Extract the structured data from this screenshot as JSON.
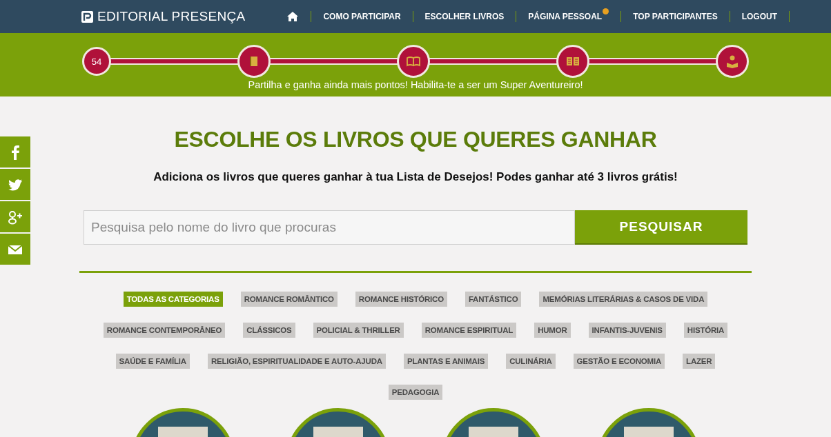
{
  "header": {
    "logo": "EDITORIAL PRESENÇA",
    "nav": [
      {
        "kind": "home"
      },
      {
        "kind": "link",
        "label": "COMO PARTICIPAR",
        "badge": false
      },
      {
        "kind": "link",
        "label": "ESCOLHER LIVROS",
        "badge": false
      },
      {
        "kind": "link",
        "label": "PÁGINA PESSOAL",
        "badge": true
      },
      {
        "kind": "link",
        "label": "TOP PARTICIPANTES",
        "badge": false
      },
      {
        "kind": "link",
        "label": "LOGOUT",
        "badge": false
      }
    ]
  },
  "progress": {
    "steps": [
      {
        "kind": "count",
        "label": "54"
      },
      {
        "kind": "book"
      },
      {
        "kind": "open-book"
      },
      {
        "kind": "text-book"
      },
      {
        "kind": "reader"
      }
    ],
    "message": "Partilha e ganha ainda mais pontos! Habilita-te a ser um Super Aventureiro!"
  },
  "social": [
    {
      "kind": "facebook"
    },
    {
      "kind": "twitter"
    },
    {
      "kind": "googleplus"
    },
    {
      "kind": "email"
    }
  ],
  "title": "ESCOLHE OS LIVROS QUE QUERES GANHAR",
  "subtitle": "Adiciona os livros que queres ganhar à tua Lista de Desejos! Podes ganhar até 3 livros grátis!",
  "search": {
    "placeholder": "Pesquisa pelo nome do livro que procuras",
    "button": "PESQUISAR"
  },
  "categories": [
    {
      "label": "TODAS AS CATEGORIAS",
      "selected": true
    },
    {
      "label": "ROMANCE ROMÂNTICO",
      "selected": false
    },
    {
      "label": "ROMANCE HISTÓRICO",
      "selected": false
    },
    {
      "label": "FANTÁSTICO",
      "selected": false
    },
    {
      "label": "MEMÓRIAS LITERÁRIAS & CASOS DE VIDA",
      "selected": false
    },
    {
      "label": "ROMANCE CONTEMPORÂNEO",
      "selected": false
    },
    {
      "label": "CLÁSSICOS",
      "selected": false
    },
    {
      "label": "POLICIAL & THRILLER",
      "selected": false
    },
    {
      "label": "ROMANCE ESPIRITUAL",
      "selected": false
    },
    {
      "label": "HUMOR",
      "selected": false
    },
    {
      "label": "INFANTIS-JUVENIS",
      "selected": false
    },
    {
      "label": "HISTÓRIA",
      "selected": false
    },
    {
      "label": "SAÚDE E FAMÍLIA",
      "selected": false
    },
    {
      "label": "RELIGIÃO, ESPIRITUALIDADE E AUTO-AJUDA",
      "selected": false
    },
    {
      "label": "PLANTAS E ANIMAIS",
      "selected": false
    },
    {
      "label": "CULINÁRIA",
      "selected": false
    },
    {
      "label": "GESTÃO E ECONOMIA",
      "selected": false
    },
    {
      "label": "LAZER",
      "selected": false
    },
    {
      "label": "PEDAGOGIA",
      "selected": false
    }
  ],
  "books": [
    {
      "kind": "cover"
    },
    {
      "kind": "cover"
    },
    {
      "kind": "cover"
    },
    {
      "kind": "cover"
    }
  ]
}
